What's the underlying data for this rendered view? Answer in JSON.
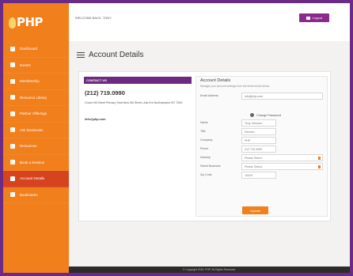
{
  "brand": {
    "logo_text": "PHP",
    "accent": "#f07f1c",
    "frame_color": "#6a2a86",
    "active_nav_color": "#d5431f",
    "header_bar_color": "#6e2a80"
  },
  "topbar": {
    "welcome_text": "WELCOME BACK, TONY",
    "logout_label": "Logout",
    "logout_icon": "exit-icon"
  },
  "sidebar": {
    "items": [
      {
        "label": "Dashboard",
        "icon": "home-icon"
      },
      {
        "label": "Events",
        "icon": "calendar-icon"
      },
      {
        "label": "Membership",
        "icon": "users-icon"
      },
      {
        "label": "Resource Library",
        "icon": "book-icon"
      },
      {
        "label": "Partner Offerings",
        "icon": "tag-icon"
      },
      {
        "label": "Ask Boatswain",
        "icon": "chat-icon"
      },
      {
        "label": "Resources",
        "icon": "download-icon"
      },
      {
        "label": "Book a Session",
        "icon": "pencil-icon"
      },
      {
        "label": "Account Details",
        "icon": "person-icon",
        "active": true
      },
      {
        "label": "Bookmarks",
        "icon": "bookmark-icon"
      }
    ]
  },
  "page": {
    "title": "Account Details",
    "menu_icon": "hamburger-icon"
  },
  "contact": {
    "header": "CONTACT US",
    "phone": "(212) 719.0990",
    "address": "Cross Hill Street Primary Seat New 9th Street, Ask Ent Northampton NY 7549",
    "email": "info@php.com"
  },
  "account": {
    "title": "Account Details",
    "subtitle": "Manage your account settings from the fields below below.",
    "change_password_label": "Change Password",
    "fields": [
      {
        "label": "Email Address",
        "value": "info@php.com",
        "kind": "text"
      },
      {
        "label": "Name",
        "value": "Tony Johnson",
        "kind": "text",
        "short": true
      },
      {
        "label": "Title",
        "value": "Director",
        "kind": "text",
        "short": true
      },
      {
        "label": "Company",
        "value": "PHP",
        "kind": "text",
        "short": true
      },
      {
        "label": "Phone",
        "value": "212 719 0990",
        "kind": "text",
        "short": true
      },
      {
        "label": "Industry",
        "value": "Please Select",
        "kind": "select"
      },
      {
        "label": "Select Business",
        "value": "Please Select",
        "kind": "select"
      },
      {
        "label": "Zip Code",
        "value": "10019",
        "kind": "text",
        "short": true
      }
    ],
    "update_label": "Update"
  },
  "footer": {
    "text": "© Copyright 2015. PHP. All Rights Reserved."
  }
}
